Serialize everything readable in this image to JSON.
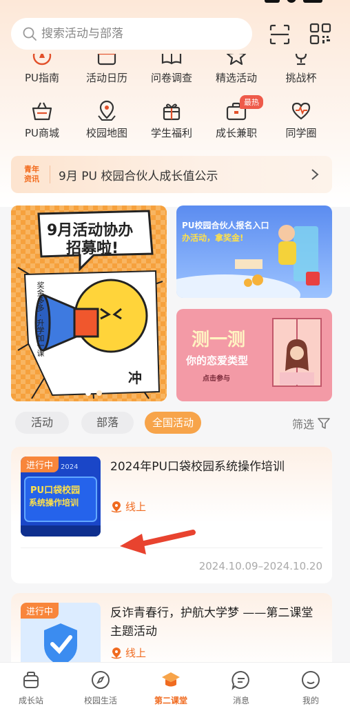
{
  "search": {
    "placeholder": "搜索活动与部落"
  },
  "grid": [
    {
      "label": "PU指南",
      "icon": "compass-icon"
    },
    {
      "label": "活动日历",
      "icon": "calendar-icon"
    },
    {
      "label": "问卷调查",
      "icon": "book-icon"
    },
    {
      "label": "精选活动",
      "icon": "star-icon"
    },
    {
      "label": "挑战杯",
      "icon": "trophy-icon"
    },
    {
      "label": "PU商城",
      "icon": "basket-icon"
    },
    {
      "label": "校园地图",
      "icon": "map-pin-icon"
    },
    {
      "label": "学生福利",
      "icon": "gift-icon"
    },
    {
      "label": "成长兼职",
      "icon": "briefcase-icon",
      "badge": "最热"
    },
    {
      "label": "同学圈",
      "icon": "heart-pulse-icon"
    }
  ],
  "news": {
    "tag_line1": "青年",
    "tag_line2": "资讯",
    "text": "9月 PU 校园合伙人成长值公示"
  },
  "banners": {
    "big": {
      "title": "9月活动协办",
      "title2": "招募啦!",
      "side": "奖金多多 · 升学加一课",
      "side_mark": "冲"
    },
    "small1": {
      "title": "PU校园合伙人报名入口",
      "subtitle": "办活动，拿奖金!"
    },
    "small2": {
      "title": "测一测",
      "subtitle": "你的恋爱类型",
      "cta": "点击参与"
    }
  },
  "filters": {
    "tab1": "活动",
    "tab2": "部落",
    "tab3": "全国活动",
    "filter": "筛选"
  },
  "cards": [
    {
      "status": "进行中",
      "title": "2024年PU口袋校园系统操作培训",
      "thumb_text1": "PU口袋校园",
      "thumb_text2": "系统操作培训",
      "thumb_year": "2024",
      "location": "线上",
      "date": "2024.10.09–2024.10.20"
    },
    {
      "status": "进行中",
      "title": "反诈青春行，护航大学梦 ——第二课堂主题活动",
      "location": "线上"
    }
  ],
  "tabs": [
    {
      "label": "成长站"
    },
    {
      "label": "校园生活"
    },
    {
      "label": "第二课堂"
    },
    {
      "label": "消息"
    },
    {
      "label": "我的"
    }
  ],
  "colors": {
    "accent": "#f06b20",
    "chip_active": "#f7a44a",
    "badge": "#ee5a4a"
  }
}
